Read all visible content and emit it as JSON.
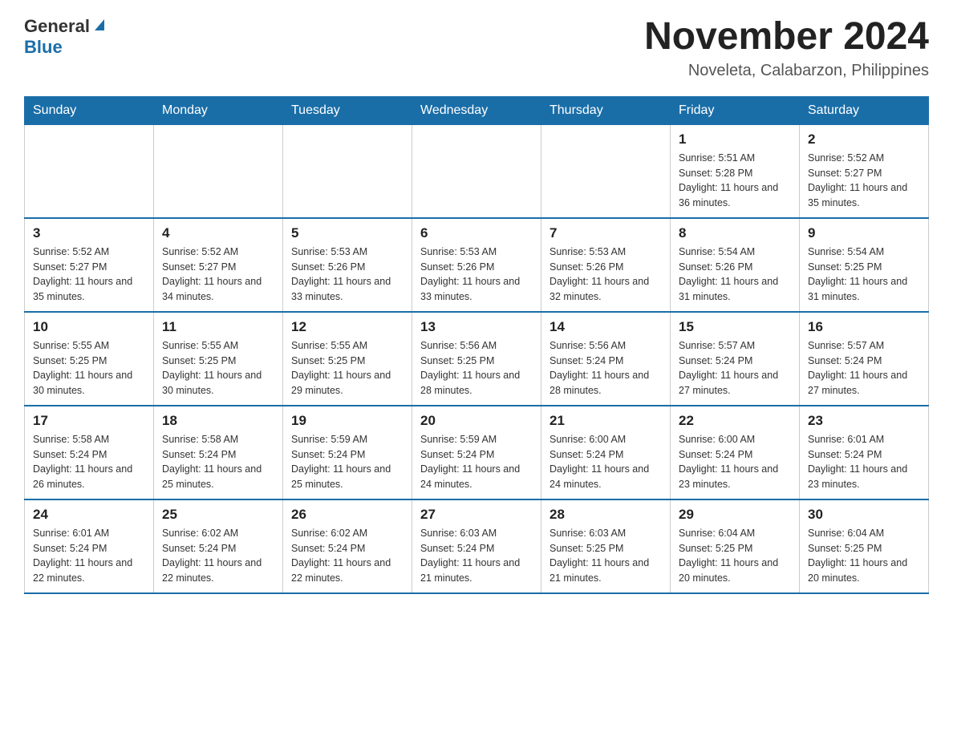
{
  "header": {
    "logo_general": "General",
    "logo_blue": "Blue",
    "month_title": "November 2024",
    "location": "Noveleta, Calabarzon, Philippines"
  },
  "weekdays": [
    "Sunday",
    "Monday",
    "Tuesday",
    "Wednesday",
    "Thursday",
    "Friday",
    "Saturday"
  ],
  "weeks": [
    [
      {
        "day": "",
        "info": ""
      },
      {
        "day": "",
        "info": ""
      },
      {
        "day": "",
        "info": ""
      },
      {
        "day": "",
        "info": ""
      },
      {
        "day": "",
        "info": ""
      },
      {
        "day": "1",
        "info": "Sunrise: 5:51 AM\nSunset: 5:28 PM\nDaylight: 11 hours and 36 minutes."
      },
      {
        "day": "2",
        "info": "Sunrise: 5:52 AM\nSunset: 5:27 PM\nDaylight: 11 hours and 35 minutes."
      }
    ],
    [
      {
        "day": "3",
        "info": "Sunrise: 5:52 AM\nSunset: 5:27 PM\nDaylight: 11 hours and 35 minutes."
      },
      {
        "day": "4",
        "info": "Sunrise: 5:52 AM\nSunset: 5:27 PM\nDaylight: 11 hours and 34 minutes."
      },
      {
        "day": "5",
        "info": "Sunrise: 5:53 AM\nSunset: 5:26 PM\nDaylight: 11 hours and 33 minutes."
      },
      {
        "day": "6",
        "info": "Sunrise: 5:53 AM\nSunset: 5:26 PM\nDaylight: 11 hours and 33 minutes."
      },
      {
        "day": "7",
        "info": "Sunrise: 5:53 AM\nSunset: 5:26 PM\nDaylight: 11 hours and 32 minutes."
      },
      {
        "day": "8",
        "info": "Sunrise: 5:54 AM\nSunset: 5:26 PM\nDaylight: 11 hours and 31 minutes."
      },
      {
        "day": "9",
        "info": "Sunrise: 5:54 AM\nSunset: 5:25 PM\nDaylight: 11 hours and 31 minutes."
      }
    ],
    [
      {
        "day": "10",
        "info": "Sunrise: 5:55 AM\nSunset: 5:25 PM\nDaylight: 11 hours and 30 minutes."
      },
      {
        "day": "11",
        "info": "Sunrise: 5:55 AM\nSunset: 5:25 PM\nDaylight: 11 hours and 30 minutes."
      },
      {
        "day": "12",
        "info": "Sunrise: 5:55 AM\nSunset: 5:25 PM\nDaylight: 11 hours and 29 minutes."
      },
      {
        "day": "13",
        "info": "Sunrise: 5:56 AM\nSunset: 5:25 PM\nDaylight: 11 hours and 28 minutes."
      },
      {
        "day": "14",
        "info": "Sunrise: 5:56 AM\nSunset: 5:24 PM\nDaylight: 11 hours and 28 minutes."
      },
      {
        "day": "15",
        "info": "Sunrise: 5:57 AM\nSunset: 5:24 PM\nDaylight: 11 hours and 27 minutes."
      },
      {
        "day": "16",
        "info": "Sunrise: 5:57 AM\nSunset: 5:24 PM\nDaylight: 11 hours and 27 minutes."
      }
    ],
    [
      {
        "day": "17",
        "info": "Sunrise: 5:58 AM\nSunset: 5:24 PM\nDaylight: 11 hours and 26 minutes."
      },
      {
        "day": "18",
        "info": "Sunrise: 5:58 AM\nSunset: 5:24 PM\nDaylight: 11 hours and 25 minutes."
      },
      {
        "day": "19",
        "info": "Sunrise: 5:59 AM\nSunset: 5:24 PM\nDaylight: 11 hours and 25 minutes."
      },
      {
        "day": "20",
        "info": "Sunrise: 5:59 AM\nSunset: 5:24 PM\nDaylight: 11 hours and 24 minutes."
      },
      {
        "day": "21",
        "info": "Sunrise: 6:00 AM\nSunset: 5:24 PM\nDaylight: 11 hours and 24 minutes."
      },
      {
        "day": "22",
        "info": "Sunrise: 6:00 AM\nSunset: 5:24 PM\nDaylight: 11 hours and 23 minutes."
      },
      {
        "day": "23",
        "info": "Sunrise: 6:01 AM\nSunset: 5:24 PM\nDaylight: 11 hours and 23 minutes."
      }
    ],
    [
      {
        "day": "24",
        "info": "Sunrise: 6:01 AM\nSunset: 5:24 PM\nDaylight: 11 hours and 22 minutes."
      },
      {
        "day": "25",
        "info": "Sunrise: 6:02 AM\nSunset: 5:24 PM\nDaylight: 11 hours and 22 minutes."
      },
      {
        "day": "26",
        "info": "Sunrise: 6:02 AM\nSunset: 5:24 PM\nDaylight: 11 hours and 22 minutes."
      },
      {
        "day": "27",
        "info": "Sunrise: 6:03 AM\nSunset: 5:24 PM\nDaylight: 11 hours and 21 minutes."
      },
      {
        "day": "28",
        "info": "Sunrise: 6:03 AM\nSunset: 5:25 PM\nDaylight: 11 hours and 21 minutes."
      },
      {
        "day": "29",
        "info": "Sunrise: 6:04 AM\nSunset: 5:25 PM\nDaylight: 11 hours and 20 minutes."
      },
      {
        "day": "30",
        "info": "Sunrise: 6:04 AM\nSunset: 5:25 PM\nDaylight: 11 hours and 20 minutes."
      }
    ]
  ]
}
